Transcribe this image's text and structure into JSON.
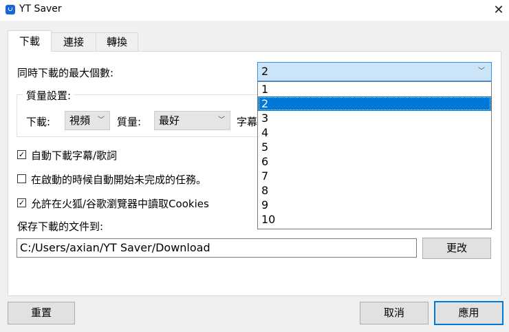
{
  "window": {
    "title": "YT Saver",
    "close_glyph": "✕"
  },
  "tabs": [
    {
      "label": "下載",
      "active": true
    },
    {
      "label": "連接",
      "active": false
    },
    {
      "label": "轉換",
      "active": false
    }
  ],
  "max_downloads": {
    "label": "同時下載的最大個數:",
    "value": "2"
  },
  "quality_group": {
    "title": "質量設置:",
    "download_label": "下載:",
    "download_value": "視頻",
    "quality_label": "質量:",
    "quality_value": "最好",
    "subtitle_label": "字幕"
  },
  "options": [
    {
      "label": "自動下載字幕/歌詞",
      "checked": true
    },
    {
      "label": "在啟動的時候自動開始未完成的任務。",
      "checked": false
    },
    {
      "label": "允許在火狐/谷歌瀏覽器中讀取Cookies",
      "checked": true
    }
  ],
  "save_path": {
    "label": "保存下載的文件到:",
    "value": "C:/Users/axian/YT Saver/Download",
    "change_button": "更改"
  },
  "footer": {
    "reset": "重置",
    "cancel": "取消",
    "apply": "應用"
  },
  "dropdown": {
    "items": [
      "1",
      "2",
      "3",
      "4",
      "5",
      "6",
      "7",
      "8",
      "9",
      "10"
    ],
    "selected": "2"
  },
  "colors": {
    "accent": "#0078d7",
    "combo_focus_bg": "#cce4f7",
    "app_icon": "#1a63d8"
  }
}
